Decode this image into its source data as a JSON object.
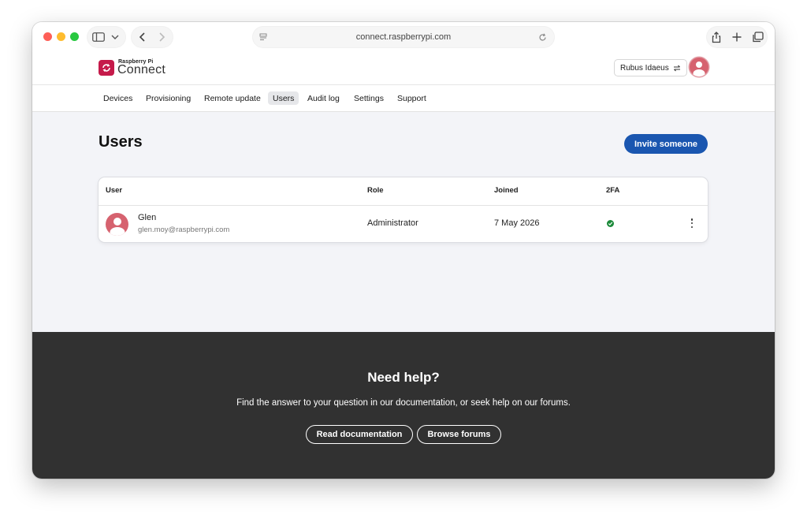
{
  "browser": {
    "url": "connect.raspberrypi.com"
  },
  "header": {
    "logo_small": "Raspberry Pi",
    "logo_big": "Connect",
    "org_name": "Rubus Idaeus"
  },
  "nav": {
    "items": [
      {
        "label": "Devices"
      },
      {
        "label": "Provisioning"
      },
      {
        "label": "Remote update"
      },
      {
        "label": "Users"
      },
      {
        "label": "Audit log"
      },
      {
        "label": "Settings"
      },
      {
        "label": "Support"
      }
    ],
    "active": "Users"
  },
  "main": {
    "title": "Users",
    "invite_label": "Invite someone",
    "table": {
      "columns": [
        "User",
        "Role",
        "Joined",
        "2FA"
      ],
      "rows": [
        {
          "name": "Glen",
          "email": "glen.moy@raspberrypi.com",
          "role": "Administrator",
          "joined": "7 May 2026",
          "twofa": "enabled"
        }
      ]
    }
  },
  "footer": {
    "title": "Need help?",
    "text": "Find the answer to your question in our documentation, or seek help on our forums.",
    "docs_label": "Read documentation",
    "forums_label": "Browse forums"
  },
  "colors": {
    "brand": "#c51a4a",
    "primary": "#1a56b0",
    "avatar": "#d6626f",
    "success": "#1c8a3a",
    "footer_bg": "#313131"
  }
}
